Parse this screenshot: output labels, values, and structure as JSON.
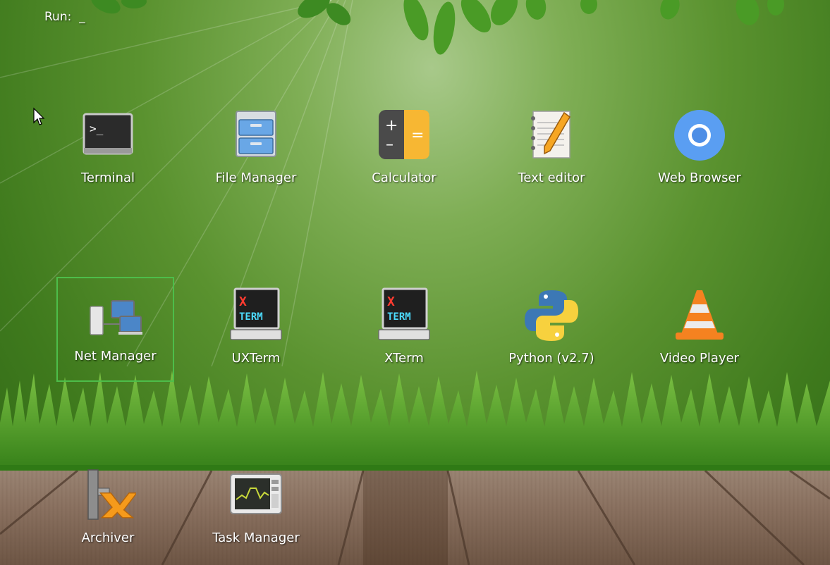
{
  "run_prompt": {
    "label": "Run:",
    "cursor": "_"
  },
  "apps": [
    {
      "label": "Terminal",
      "icon": "terminal-icon"
    },
    {
      "label": "File Manager",
      "icon": "file-cabinet-icon"
    },
    {
      "label": "Calculator",
      "icon": "calculator-icon"
    },
    {
      "label": "Text editor",
      "icon": "notepad-pencil-icon"
    },
    {
      "label": "Web Browser",
      "icon": "browser-globe-icon"
    },
    {
      "label": "Net Manager",
      "icon": "network-computers-icon",
      "selected": true
    },
    {
      "label": "UXTerm",
      "icon": "xterm-monitor-icon"
    },
    {
      "label": "XTerm",
      "icon": "xterm-monitor-icon"
    },
    {
      "label": "Python (v2.7)",
      "icon": "python-logo-icon"
    },
    {
      "label": "Video Player",
      "icon": "traffic-cone-icon"
    },
    {
      "label": "Archiver",
      "icon": "vise-archive-icon"
    },
    {
      "label": "Task Manager",
      "icon": "system-monitor-icon"
    }
  ],
  "colors": {
    "selection_border": "#4dbd4a",
    "label_text": "#ffffff"
  }
}
